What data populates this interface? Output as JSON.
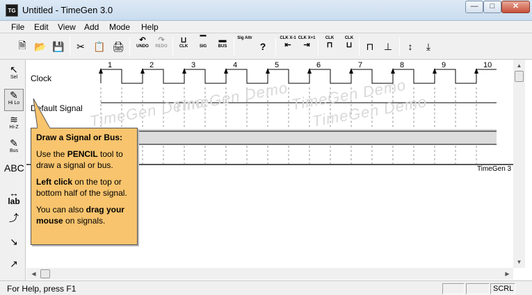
{
  "window": {
    "title": "Untitled - TimeGen 3.0",
    "app_icon_text": "TG",
    "minimize_icon": "minimize-icon",
    "maximize_icon": "maximize-icon",
    "close_icon": "close-icon"
  },
  "menu": {
    "items": [
      "File",
      "Edit",
      "View",
      "Add",
      "Mode",
      "Help"
    ]
  },
  "toolbar": {
    "undo_label": "UNDO",
    "redo_label": "REDO",
    "clk_label": "CLK",
    "sig_label": "SIG",
    "bus_label": "BUS",
    "sig_attr_label": "Sig Attr",
    "help_glyph": "?",
    "clk_x1_label": "CLK X-1",
    "clk_x1_plus_label": "CLK X+1",
    "clk_a_label": "CLK",
    "clk_b_label": "CLK"
  },
  "toolbox": {
    "items": [
      {
        "label": "Sel",
        "icon": "arrow-icon"
      },
      {
        "label": "Hi Lo",
        "icon": "pencil-icon"
      },
      {
        "label": "Hi-Z",
        "icon": "hiz-icon"
      },
      {
        "label": "Bus",
        "icon": "bus-pencil-icon"
      },
      {
        "label": "ABC",
        "icon": "text-icon"
      },
      {
        "label": "lab",
        "icon": "label-icon"
      },
      {
        "label": "",
        "icon": "curve-arrow-icon"
      },
      {
        "label": "",
        "icon": "bent-arrow-icon"
      },
      {
        "label": "",
        "icon": "line-icon"
      }
    ]
  },
  "diagram": {
    "signals": [
      "Clock",
      "Default Signal"
    ],
    "clock_numbers": [
      "1",
      "2",
      "3",
      "4",
      "5",
      "6",
      "7",
      "8",
      "9",
      "10"
    ],
    "watermarks": [
      "TimeGen Demo",
      "TimeGen Demo",
      "TimeGen Demo",
      "TimeGen Demo"
    ],
    "footer": "TimeGen 3"
  },
  "tooltip": {
    "title": "Draw a Signal or Bus:",
    "p1_a": "Use the ",
    "p1_bold": "PENCIL",
    "p1_b": " tool to draw a signal or bus.",
    "p2_bold": "Left click",
    "p2_b": " on the top or bottom half of the signal.",
    "p3_a": "You can also ",
    "p3_bold": "drag your mouse",
    "p3_b": " on signals."
  },
  "statusbar": {
    "help": "For Help, press F1",
    "scrl": "SCRL"
  }
}
